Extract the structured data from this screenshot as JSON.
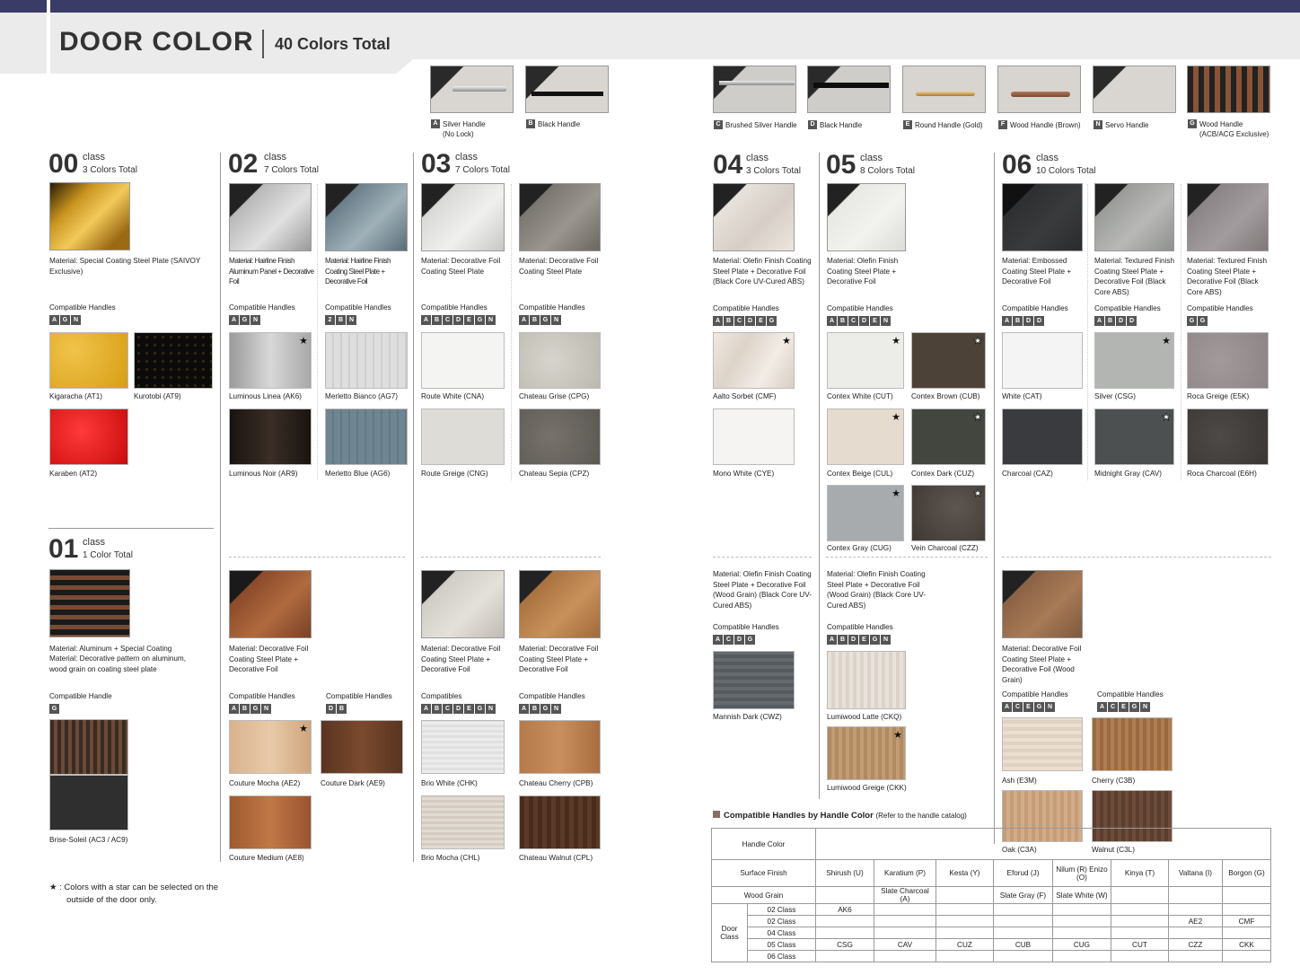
{
  "header": {
    "title": "DOOR COLOR",
    "subtitle": "40 Colors Total"
  },
  "colors": {
    "navy": "#3a3b66",
    "code_badge": "#555555"
  },
  "handles": [
    {
      "code": "A",
      "name": "Silver Handle",
      "sub": "(No Lock)"
    },
    {
      "code": "B",
      "name": "Black Handle",
      "sub": ""
    },
    {
      "code": "C",
      "name": "Brushed Silver Handle",
      "sub": ""
    },
    {
      "code": "D",
      "name": "Black Handle",
      "sub": ""
    },
    {
      "code": "E",
      "name": "Round Handle (Gold)",
      "sub": ""
    },
    {
      "code": "F",
      "name": "Wood Handle (Brown)",
      "sub": ""
    },
    {
      "code": "N",
      "name": "Servo Handle",
      "sub": ""
    },
    {
      "code": "G",
      "name": "Wood Handle",
      "sub": "(ACB/ACG Exclusive)"
    }
  ],
  "common": {
    "class_word": "class",
    "compat_handles": "Compatible Handles",
    "compat_handle": "Compatible Handle",
    "compat_garbled": "Compatibles"
  },
  "class00": {
    "num": "00",
    "total": "3 Colors Total",
    "material": "Material: Special Coating Steel Plate (SAIVOY Exclusive)",
    "codes": [
      "A",
      "G",
      "N"
    ],
    "swatches": [
      "Kigaracha (AT1)",
      "Kurotobi (AT9)",
      "Karaben (AT2)"
    ]
  },
  "class01": {
    "num": "01",
    "total": "1 Color Total",
    "material1": "Material: Aluminum + Special Coating",
    "material2": "Material: Decorative pattern on aluminum, wood grain on coating steel plate",
    "codes": [
      "G"
    ],
    "swatches": [
      "Brise-Soleil (AC3 / AC9)"
    ]
  },
  "class02": {
    "num": "02",
    "total": "7 Colors Total",
    "colA": {
      "material": "Material: Hairline Finish Aluminum Panel + Decorative Foil",
      "codes": [
        "A",
        "G",
        "N"
      ],
      "swatches": [
        "Luminous Linea (AK6)",
        "Luminous Noir (AR9)"
      ]
    },
    "colB": {
      "material": "Material: Hairline Finish Coating Steel Plate + Decorative Foil",
      "codes": [
        "2",
        "B",
        "N"
      ],
      "swatches": [
        "Merletto Bianco (AG7)",
        "Merletto Blue (AG6)"
      ]
    },
    "lower": {
      "material": "Material: Decorative Foil Coating Steel Plate + Decorative Foil",
      "codesA": [
        "A",
        "B",
        "G",
        "N"
      ],
      "codesB": [
        "D",
        "B"
      ],
      "swatches": [
        "Couture Mocha (AE2)",
        "Couture Dark (AE9)",
        "Couture Medium (AE8)"
      ]
    }
  },
  "class03": {
    "num": "03",
    "total": "7 Colors Total",
    "colA": {
      "material": "Material: Decorative Foil Coating Steel Plate",
      "codes": [
        "A",
        "B",
        "C",
        "D",
        "E",
        "G",
        "N"
      ],
      "swatches": [
        "Route White (CNA)",
        "Route Greige (CNG)"
      ]
    },
    "colB": {
      "material": "Material: Decorative Foil Coating Steel Plate",
      "codes": [
        "A",
        "B",
        "G",
        "N"
      ],
      "swatches": [
        "Chateau Grise (CPG)",
        "Chateau Sepia (CPZ)"
      ]
    },
    "lowerA": {
      "material": "Material: Decorative Foil Coating Steel Plate + Decorative Foil",
      "codes": [
        "A",
        "B",
        "C",
        "D",
        "E",
        "G",
        "N"
      ],
      "swatches": [
        "Brio White (CHK)",
        "Brio Mocha (CHL)"
      ]
    },
    "lowerB": {
      "material": "Material: Decorative Foil Coating Steel Plate + Decorative Foil",
      "codes": [
        "A",
        "B",
        "G",
        "N"
      ],
      "swatches": [
        "Chateau Cherry (CPB)",
        "Chateau Walnut (CPL)"
      ]
    }
  },
  "class04": {
    "num": "04",
    "total": "3 Colors Total",
    "material": "Material: Olefin Finish Coating Steel Plate + Decorative Foil (Black Core UV-Cured ABS)",
    "codes": [
      "A",
      "B",
      "C",
      "D",
      "E",
      "G"
    ],
    "swatches": [
      "Aalto Sorbet (CMF)",
      "Mono White (CYE)"
    ],
    "lower": {
      "material": "Material: Olefin Finish Coating Steel Plate + Decorative Foil (Wood Grain) (Black Core UV-Cured ABS)",
      "codes": [
        "A",
        "C",
        "D",
        "G"
      ],
      "swatches": [
        "Mannish Dark (CWZ)"
      ]
    }
  },
  "class05": {
    "num": "05",
    "total": "8 Colors Total",
    "material": "Material: Olefin Finish Coating Steel Plate + Decorative Foil",
    "codes": [
      "A",
      "B",
      "C",
      "D",
      "E",
      "N"
    ],
    "swatches": [
      "Contex White (CUT)",
      "Contex Brown (CUB)",
      "Contex Beige (CUL)",
      "Contex Dark (CUZ)",
      "Contex Gray (CUG)",
      "Vein Charcoal (CZZ)"
    ],
    "lower": {
      "material": "Material: Olefin Finish Coating Steel Plate + Decorative Foil (Wood Grain) (Black Core UV-Cured ABS)",
      "codes": [
        "A",
        "B",
        "D",
        "E",
        "G",
        "N"
      ],
      "swatches": [
        "Lumiwood Latte (CKQ)",
        "Lumiwood Greige (CKK)"
      ]
    }
  },
  "class06": {
    "num": "06",
    "total": "10 Colors Total",
    "colA": {
      "material": "Material: Embossed Coating Steel Plate + Decorative Foil",
      "codes": [
        "A",
        "B",
        "D",
        "D"
      ],
      "swatches": [
        "White (CAT)",
        "Charcoal (CAZ)"
      ]
    },
    "colB": {
      "material": "Material: Textured Finish Coating Steel Plate + Decorative Foil (Black Core ABS)",
      "codes": [
        "A",
        "B",
        "D",
        "D"
      ],
      "swatches": [
        "Silver (CSG)",
        "Midnight Gray (CAV)"
      ]
    },
    "colC": {
      "material": "Material: Textured Finish Coating Steel Plate + Decorative Foil (Black Core ABS)",
      "codes": [
        "G",
        "G"
      ],
      "swatches": [
        "Roca Greige (E5K)",
        "Roca Charcoal (E6H)"
      ]
    },
    "lower": {
      "material": "Material: Decorative Foil Coating Steel Plate + Decorative Foil (Wood Grain)",
      "codesA": [
        "A",
        "C",
        "E",
        "G",
        "N"
      ],
      "codesB": [
        "A",
        "C",
        "E",
        "G",
        "N"
      ],
      "swatches": [
        "Ash (E3M)",
        "Cherry (C3B)",
        "Oak (C3A)",
        "Walnut (C3L)"
      ]
    }
  },
  "star_note": {
    "line1": "★ : Colors with a star can be selected on the",
    "line2": "outside of the door only."
  },
  "table": {
    "legend": "Compatible Handles by Handle Color",
    "legend_ref": "(Refer to the handle catalog)",
    "row_labels": {
      "handle_color": "Handle Color",
      "surface": "Surface Finish",
      "wood": "Wood Grain",
      "door_class": "Door Class"
    },
    "surface": [
      "Shirush (U)",
      "Karatium (P)",
      "Kesta (Y)",
      "Eforud (J)",
      "Nilum (R) Enizo (O)",
      "Kinya (T)",
      "Valtana (I)",
      "Borgon (G)"
    ],
    "wood": [
      "",
      "Slate Charcoal (A)",
      "",
      "Slate Gray (F)",
      "Slate White (W)",
      "",
      "",
      ""
    ],
    "classes": [
      "02 Class",
      "02 Class",
      "04 Class",
      "05 Class",
      "06 Class"
    ],
    "cells": [
      [
        "AK6",
        "",
        "",
        "",
        "",
        "",
        "",
        ""
      ],
      [
        "",
        "",
        "",
        "",
        "",
        "",
        "AE2",
        "CMF"
      ],
      [
        "",
        "",
        "",
        "",
        "",
        "",
        "",
        ""
      ],
      [
        "CSG",
        "CAV",
        "CUZ",
        "CUB",
        "CUG",
        "CUT",
        "CZZ",
        "CKK"
      ],
      [
        "",
        "",
        "",
        "",
        "",
        "",
        "",
        ""
      ]
    ]
  }
}
